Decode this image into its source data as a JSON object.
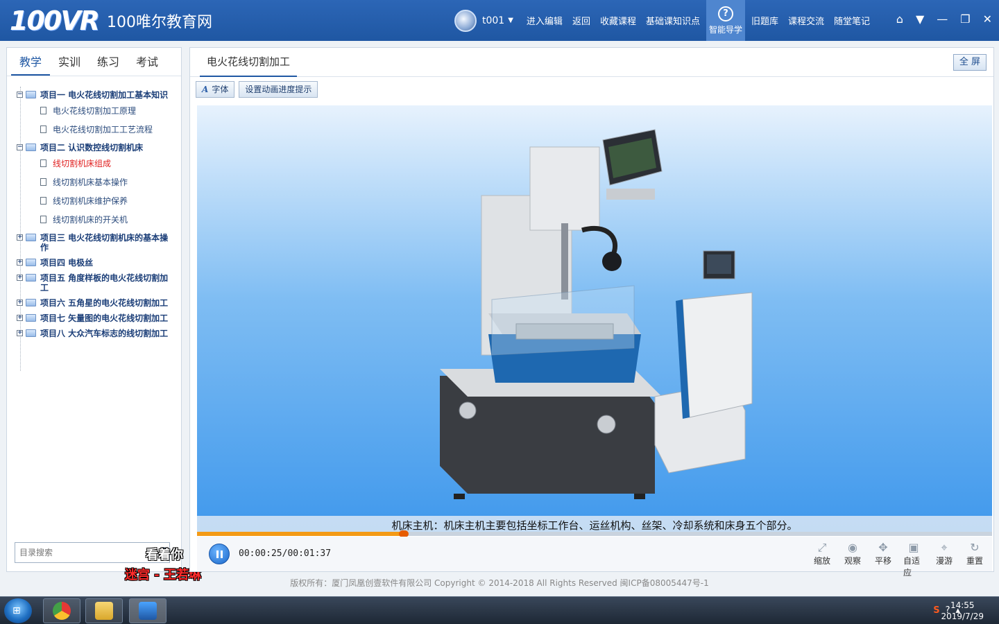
{
  "header": {
    "logo_mark": "100VR",
    "site_name": "100唯尔教育网",
    "user_name": "t001",
    "nav": [
      "进入编辑",
      "返回",
      "收藏课程",
      "基础课知识点"
    ],
    "nav_active": "智能导学",
    "nav_after": [
      "旧题库",
      "课程交流",
      "随堂笔记"
    ]
  },
  "left_tabs": [
    "教学",
    "实训",
    "练习",
    "考试"
  ],
  "tree": [
    {
      "label": "项目一  电火花线切割加工基本知识",
      "expanded": true,
      "children": [
        "电火花线切割加工原理",
        "电火花线切割加工工艺流程"
      ]
    },
    {
      "label": "项目二  认识数控线切割机床",
      "expanded": true,
      "children": [
        "线切割机床组成",
        "线切割机床基本操作",
        "线切割机床维护保养",
        "线切割机床的开关机"
      ]
    },
    {
      "label": "项目三  电火花线切割机床的基本操作",
      "expanded": false,
      "children": []
    },
    {
      "label": "项目四  电极丝",
      "expanded": false,
      "children": []
    },
    {
      "label": "项目五  角度样板的电火花线切割加工",
      "expanded": false,
      "children": []
    },
    {
      "label": "项目六  五角星的电火花线切割加工",
      "expanded": false,
      "children": []
    },
    {
      "label": "项目七  矢量图的电火花线切割加工",
      "expanded": false,
      "children": []
    },
    {
      "label": "项目八  大众汽车标志的线切割加工",
      "expanded": false,
      "children": []
    }
  ],
  "active_leaf": "线切割机床组成",
  "search_placeholder": "目录搜索",
  "overlay": {
    "line1": "看着你",
    "line2": "迷宫 - 王若琳"
  },
  "content_tab": "电火花线切割加工",
  "fullscreen_label": "全 屏",
  "toolbar": {
    "font_label": "字体",
    "progress_hint_label": "设置动画进度提示"
  },
  "caption": "机床主机：机床主机主要包括坐标工作台、运丝机构、丝架、冷却系统和床身五个部分。",
  "player": {
    "time": "00:00:25/00:01:37",
    "progress": 0.26
  },
  "view_controls": [
    "缩放",
    "观察",
    "平移",
    "自适应",
    "漫游",
    "重置"
  ],
  "footer": "版权所有：厦门凤凰创壹软件有限公司    Copyright © 2014-2018    All Rights Reserved    闽ICP备08005447号-1",
  "clock": {
    "time": "14:55",
    "date": "2019/7/29"
  },
  "colors": {
    "header": "#1f57a3",
    "accent": "#f39a16",
    "active_leaf": "#e02020"
  }
}
